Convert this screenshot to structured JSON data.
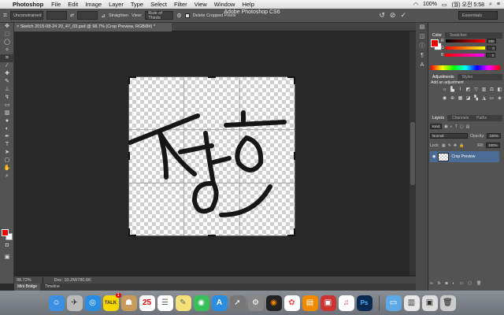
{
  "menubar": {
    "app": "Photoshop",
    "items": [
      "File",
      "Edit",
      "Image",
      "Layer",
      "Type",
      "Select",
      "Filter",
      "View",
      "Window",
      "Help"
    ],
    "battery": "100%",
    "clock": "(월) 오전 5:58"
  },
  "window": {
    "title": "Adobe Photoshop CS6"
  },
  "options": {
    "ratio": "Unconstrained",
    "straighten": "Straighten",
    "view_label": "View:",
    "view_value": "Rule of Thirds",
    "delete_cropped": "Delete Cropped Pixels",
    "workspace": "Essentials"
  },
  "document": {
    "tab": "Sketch 2015-08-24 20_47_03.psd @ 98.7% (Crop Preview, RGB/8#) *",
    "zoom": "98.72%",
    "doc_size": "Doc: 10.2M/780.6K"
  },
  "bottom_tabs": [
    "Mini Bridge",
    "Timeline"
  ],
  "panels": {
    "color_tabs": [
      "Color",
      "Swatches"
    ],
    "channels": [
      {
        "label": "R",
        "value": "255",
        "color": "#ff0000"
      },
      {
        "label": "G",
        "value": "0",
        "color": "#ffff00"
      },
      {
        "label": "B",
        "value": "0",
        "color": "#ff00ff"
      }
    ],
    "adjust_tabs": [
      "Adjustments",
      "Styles"
    ],
    "add_adjustment": "Add an adjustment",
    "layer_tabs": [
      "Layers",
      "Channels",
      "Paths"
    ],
    "kind": "Kind",
    "blend": "Normal",
    "opacity_label": "Opacity:",
    "opacity": "100%",
    "lock_label": "Lock:",
    "fill_label": "Fill:",
    "fill": "100%",
    "layer_name": "Crop Preview"
  },
  "dock": {
    "badge": "1",
    "calendar_day": "25"
  }
}
